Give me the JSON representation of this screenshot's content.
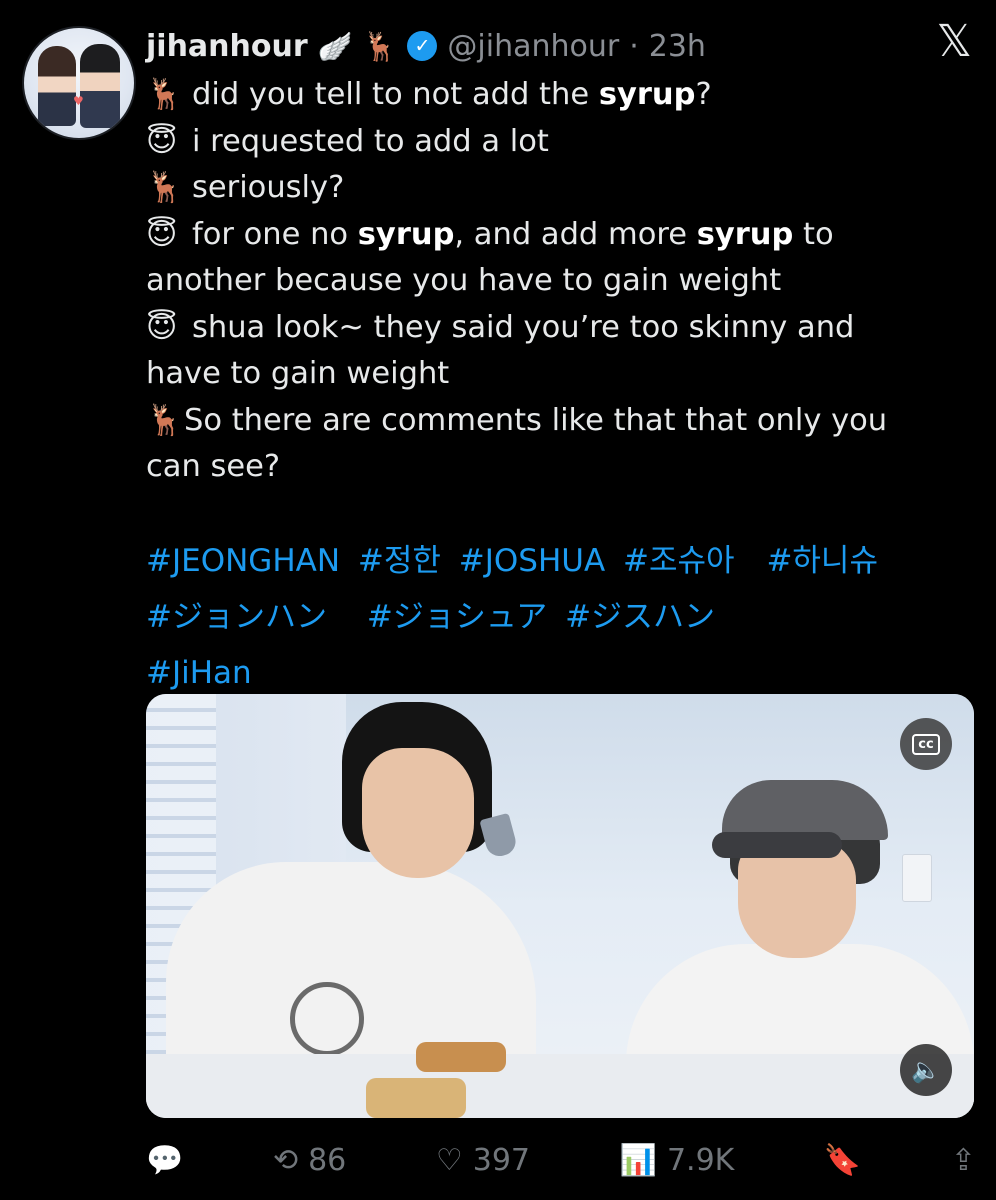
{
  "header": {
    "name": "jihanhour",
    "name_emoji1": "🪽",
    "name_emoji2": "🦌",
    "verified_mark": "✓",
    "handle": "@jihanhour",
    "separator": "·",
    "time": "23h",
    "close_icon": "𝕏"
  },
  "tweet": {
    "lines": [
      {
        "icon": "🦌",
        "pre": "did you tell to not add the ",
        "b1": "syrup",
        "post": "?"
      },
      {
        "icon": "😇",
        "text": "i requested to add a lot"
      },
      {
        "icon": "🦌",
        "text": "seriously?"
      },
      {
        "icon": "😇",
        "pre": "for one no ",
        "b1": "syrup",
        "mid": ", and add more ",
        "b2": "syrup",
        "post": " to"
      },
      {
        "text": "another because you have to gain weight"
      },
      {
        "icon": "😇",
        "text": "shua look~ they said you’re too skinny and"
      },
      {
        "text": "have to gain weight"
      },
      {
        "icon": "🦌",
        "text": "So there are comments like that that only you"
      },
      {
        "text": "can see?"
      }
    ]
  },
  "hashtags": {
    "row1": [
      "#JEONGHAN",
      "#정한",
      "#JOSHUA",
      "#조슈아",
      "#하니슈"
    ],
    "row2": [
      "#ジョンハン",
      "#ジョシュア",
      "#ジスハン"
    ],
    "row3": [
      "#JiHan"
    ]
  },
  "media": {
    "cc_label": "cc",
    "volume_icon": "🔈"
  },
  "actions": {
    "reply_icon": "💬",
    "retweet_icon": "⟲",
    "retweets": "86",
    "like_icon": "♡",
    "likes": "397",
    "views_icon": "📊",
    "views": "7.9K",
    "bookmark_icon": "🔖",
    "share_icon": "⇪"
  },
  "colors": {
    "background": "#000000",
    "text": "#e7e9ea",
    "muted": "#71767b",
    "link": "#1d9bf0",
    "verified": "#1d9bf0"
  }
}
